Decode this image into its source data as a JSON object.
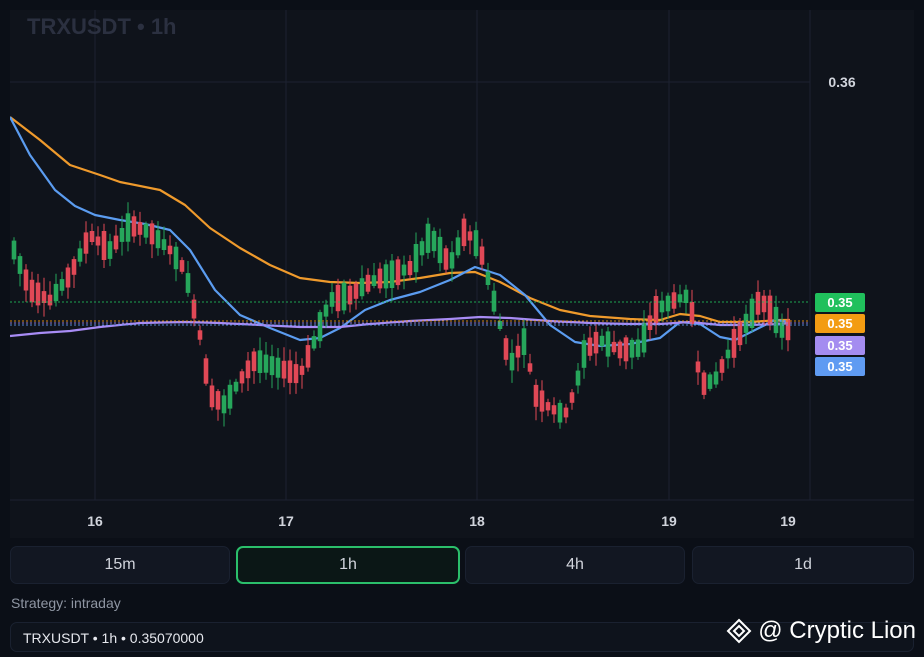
{
  "symbol_title": "TRXUSDT • 1h",
  "chart_data": {
    "type": "candlestick",
    "title": "TRXUSDT • 1h",
    "x_tick_labels": [
      "16",
      "17",
      "18",
      "19",
      "19"
    ],
    "y_tick_labels": [
      "0.36"
    ],
    "series": [
      {
        "name": "",
        "color": "#ef9a2c"
      },
      {
        "name": "",
        "color": "#5b9cf0"
      },
      {
        "name": "",
        "color": "#a88cf5"
      }
    ],
    "price_labels": [
      {
        "text": "0.35",
        "color": "#20c05c"
      },
      {
        "text": "0.35",
        "color": "#f39c12"
      },
      {
        "text": "0.35",
        "color": "#a48cf0"
      },
      {
        "text": "0.35",
        "color": "#5f9bf2"
      }
    ],
    "colors": {
      "up": "#26a65b",
      "down": "#e04856",
      "grid": "#1c2230"
    }
  },
  "interval_tabs": [
    {
      "label": "15m"
    },
    {
      "label": "1h"
    },
    {
      "label": "4h"
    },
    {
      "label": "1d"
    }
  ],
  "active_tab": "1h",
  "strategy_text": "Strategy: intraday",
  "status_text": "TRXUSDT • 1h • 0.35070000",
  "brand_text": "@ Cryptic Lion"
}
